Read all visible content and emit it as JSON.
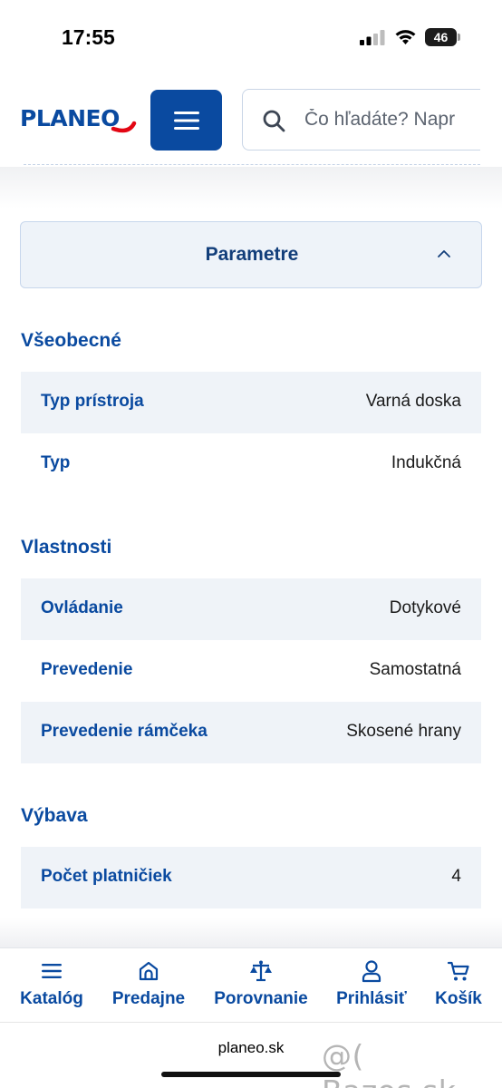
{
  "status_bar": {
    "time": "17:55",
    "battery": "46",
    "icons": [
      "signal-icon",
      "wifi-icon",
      "battery-icon"
    ]
  },
  "header": {
    "logo": "PLANEO",
    "menu_icon": "hamburger-icon",
    "search": {
      "placeholder": "Čo hľadáte? Napr",
      "icon": "search-icon"
    }
  },
  "accordion": {
    "title": "Parametre",
    "icon": "chevron-up-icon",
    "expanded": true
  },
  "sections": [
    {
      "title": "Všeobecné",
      "rows": [
        {
          "label": "Typ prístroja",
          "value": "Varná doska"
        },
        {
          "label": "Typ",
          "value": "Indukčná"
        }
      ]
    },
    {
      "title": "Vlastnosti",
      "rows": [
        {
          "label": "Ovládanie",
          "value": "Dotykové"
        },
        {
          "label": "Prevedenie",
          "value": "Samostatná"
        },
        {
          "label": "Prevedenie rámčeka",
          "value": "Skosené hrany"
        }
      ]
    },
    {
      "title": "Výbava",
      "rows": [
        {
          "label": "Počet platničiek",
          "value": "4"
        }
      ]
    }
  ],
  "bottom_nav": {
    "items": [
      {
        "label": "Katalóg",
        "icon": "hamburger-icon"
      },
      {
        "label": "Predajne",
        "icon": "store-icon"
      },
      {
        "label": "Porovnanie",
        "icon": "scales-icon"
      },
      {
        "label": "Prihlásiť",
        "icon": "user-icon"
      },
      {
        "label": "Košík",
        "icon": "cart-icon"
      }
    ]
  },
  "browser": {
    "url": "planeo.sk"
  },
  "watermark": "@( Bazos.sk",
  "colors": {
    "brand_blue": "#0a4aa0",
    "logo_red": "#e30613",
    "row_shade": "#eff3f8"
  }
}
